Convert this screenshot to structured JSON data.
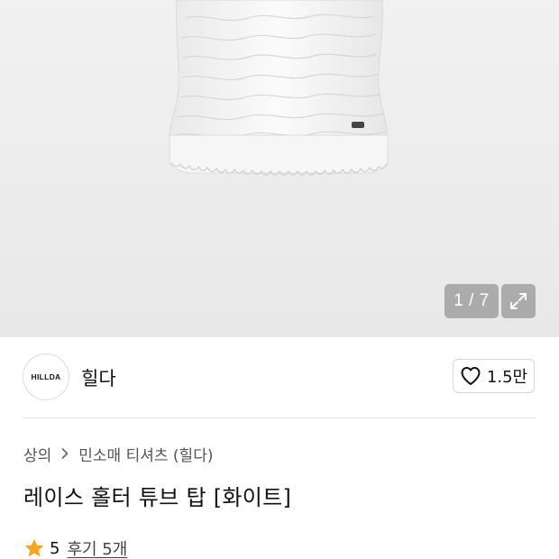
{
  "gallery": {
    "counter": "1 / 7",
    "expand_icon": "expand-icon"
  },
  "brand": {
    "logo_text": "HILLDA",
    "name": "힐다",
    "like_count": "1.5만",
    "like_icon": "heart-outline-icon"
  },
  "product": {
    "breadcrumb": {
      "category": "상의",
      "subcategory": "민소매 티셔츠 (힐다)",
      "separator_icon": "chevron-right-icon"
    },
    "title": "레이스 홀터 튜브 탑 [화이트]",
    "rating": {
      "star_icon": "star-icon",
      "star_color": "#F5A623",
      "score": "5",
      "review_link": "후기 5개"
    }
  }
}
